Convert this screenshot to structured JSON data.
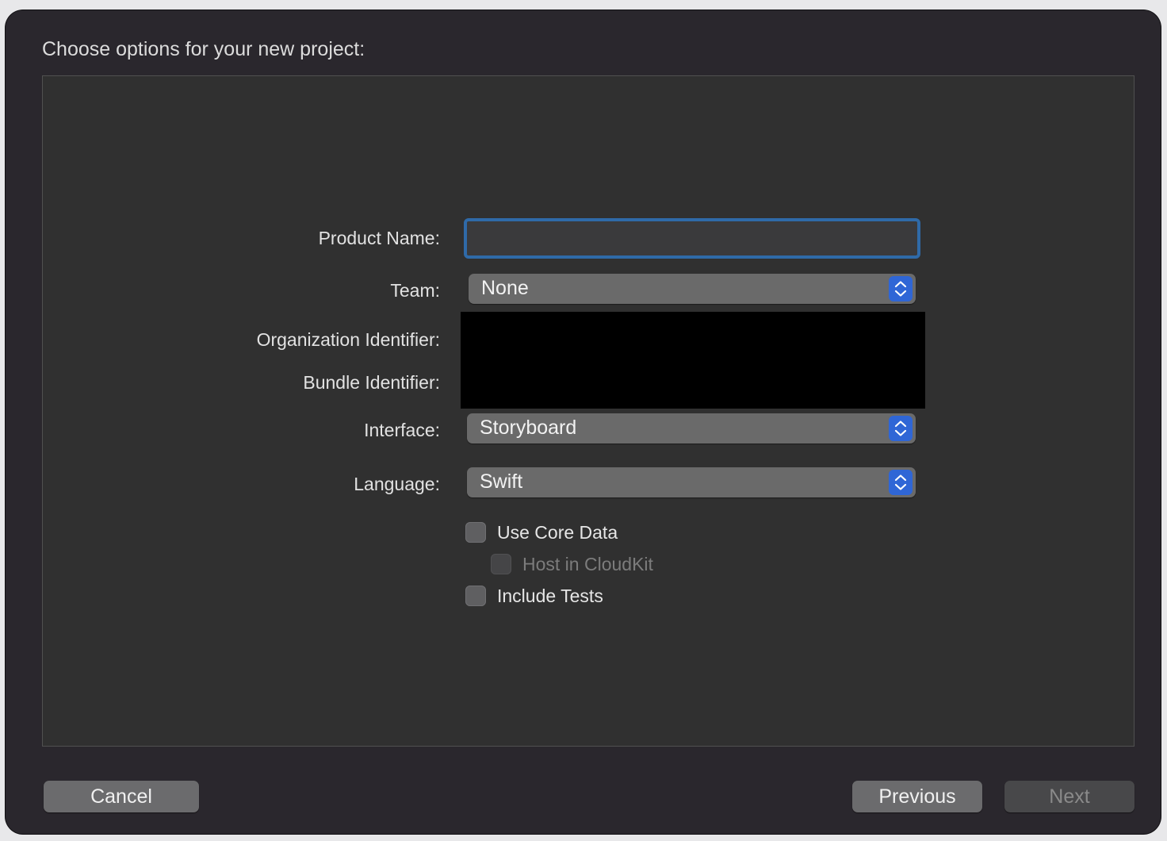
{
  "dialog": {
    "title": "Choose options for your new project:"
  },
  "form": {
    "product_name": {
      "label": "Product Name:",
      "value": ""
    },
    "team": {
      "label": "Team:",
      "value": "None"
    },
    "organization_identifier": {
      "label": "Organization Identifier:"
    },
    "bundle_identifier": {
      "label": "Bundle Identifier:"
    },
    "interface": {
      "label": "Interface:",
      "value": "Storyboard"
    },
    "language": {
      "label": "Language:",
      "value": "Swift"
    },
    "options": [
      {
        "label": "Use Core Data",
        "checked": false,
        "enabled": true
      },
      {
        "label": "Host in CloudKit",
        "checked": false,
        "enabled": false
      },
      {
        "label": "Include Tests",
        "checked": false,
        "enabled": true
      }
    ]
  },
  "footer": {
    "cancel_label": "Cancel",
    "previous_label": "Previous",
    "next_label": "Next",
    "next_enabled": false
  },
  "colors": {
    "window_background": "#2a272d",
    "panel_background": "#303030",
    "focus_ring": "#2f6aa8",
    "popup_stepper_accent": "#2f66d6",
    "redaction": "#000000"
  },
  "icons": {
    "popup_indicator": "chevron-up-down-icon"
  }
}
